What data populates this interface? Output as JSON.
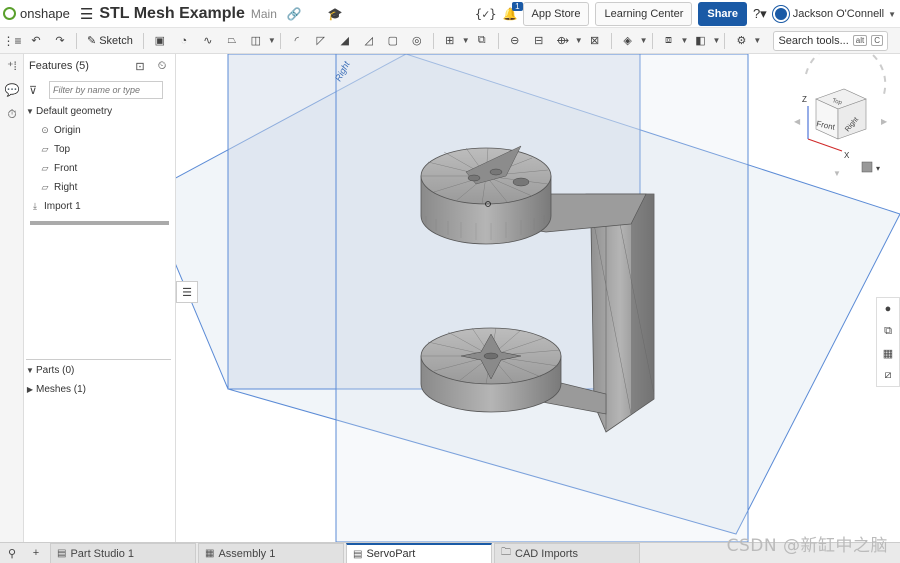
{
  "app": {
    "brand": "onshape",
    "document_title": "STL Mesh Example",
    "branch": "Main"
  },
  "header": {
    "variables_icon": "{✓}",
    "notification_count": "1",
    "app_store": "App Store",
    "learning_center": "Learning Center",
    "share": "Share",
    "help_icon": "?",
    "user_name": "Jackson O'Connell"
  },
  "toolbar": {
    "sketch_label": "Sketch",
    "search_tools": "Search tools...",
    "search_shortcut_1": "alt",
    "search_shortcut_2": "C"
  },
  "feature_panel": {
    "title": "Features (5)",
    "filter_placeholder": "Filter by name or type",
    "default_geometry": "Default geometry",
    "items": [
      "Origin",
      "Top",
      "Front",
      "Right"
    ],
    "import": "Import 1",
    "parts": "Parts (0)",
    "meshes": "Meshes (1)"
  },
  "viewport": {
    "plane_label": "Right",
    "cube_front": "Front",
    "cube_right": "Right",
    "cube_top": "Top",
    "axis_x": "X",
    "axis_z": "Z"
  },
  "tabs": [
    {
      "label": "Part Studio 1",
      "icon": "part-studio-icon"
    },
    {
      "label": "Assembly 1",
      "icon": "assembly-icon"
    },
    {
      "label": "ServoPart",
      "icon": "part-studio-icon",
      "active": true
    },
    {
      "label": "CAD Imports",
      "icon": "folder-icon"
    }
  ],
  "watermark": "CSDN @新缸中之脑",
  "colors": {
    "brand_green": "#5aa02c",
    "primary_blue": "#1a5aa6",
    "plane_stroke": "#5b8bd6"
  }
}
